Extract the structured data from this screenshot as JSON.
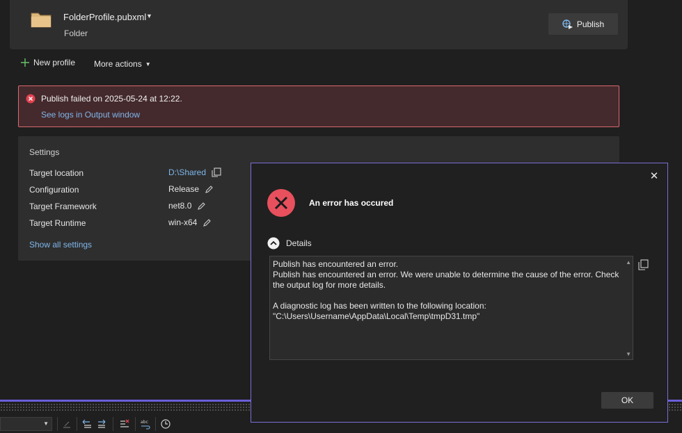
{
  "profile": {
    "name": "FolderProfile.pubxml",
    "type": "Folder",
    "publish_label": "Publish"
  },
  "toolbar": {
    "new_profile": "New profile",
    "more_actions": "More actions"
  },
  "error_banner": {
    "message": "Publish failed on 2025-05-24 at 12:22.",
    "link": "See logs in Output window"
  },
  "settings": {
    "title": "Settings",
    "rows": [
      {
        "label": "Target location",
        "value": "D:\\Shared",
        "action": "copy-icon"
      },
      {
        "label": "Configuration",
        "value": "Release",
        "action": "pencil-icon"
      },
      {
        "label": "Target Framework",
        "value": "net8.0",
        "action": "pencil-icon"
      },
      {
        "label": "Target Runtime",
        "value": "win-x64",
        "action": "pencil-icon"
      }
    ],
    "show_all": "Show all settings"
  },
  "dialog": {
    "title": "An error has occured",
    "details_label": "Details",
    "lines": [
      "Publish has encountered an error.",
      "Publish has encountered an error. We were unable to determine the cause of the error. Check the output log for more details.",
      "",
      "A diagnostic log has been written to the following location:",
      "\"C:\\Users\\Username\\AppData\\Local\\Temp\\tmpD31.tmp\""
    ],
    "ok_label": "OK"
  },
  "colors": {
    "accent": "#7a6fd8",
    "error": "#e0424f",
    "link": "#7fb6ea",
    "folder": "#dcb67a"
  }
}
